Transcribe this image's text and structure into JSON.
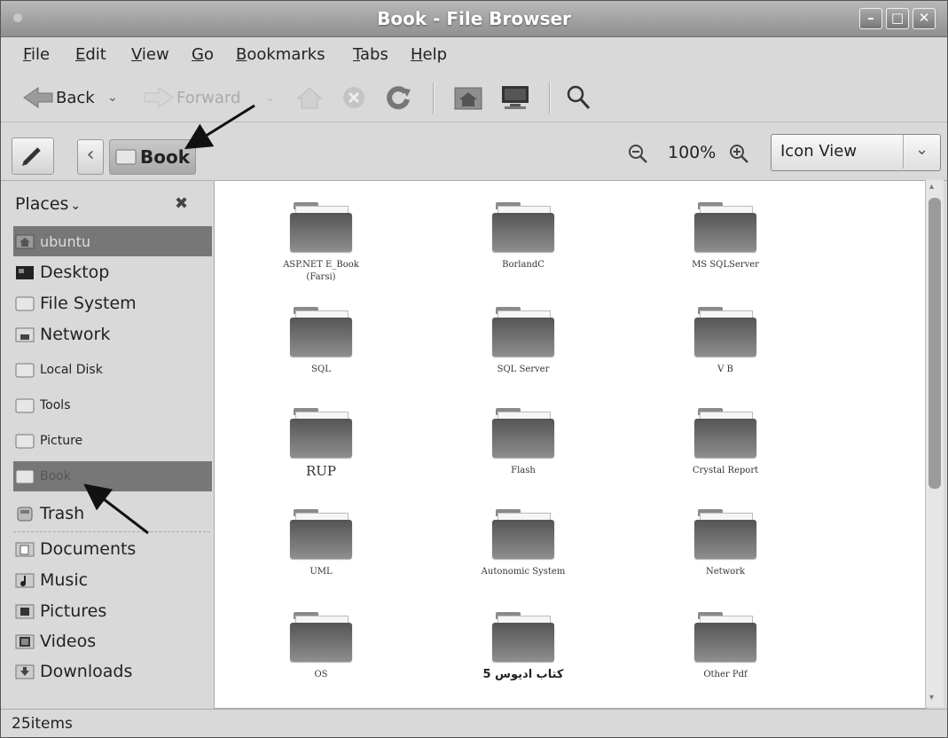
{
  "window": {
    "title": "Book - File Browser",
    "controls": [
      "–",
      "□",
      "✕"
    ]
  },
  "menubar": {
    "items": [
      {
        "pre": "",
        "key": "F",
        "post": "ile"
      },
      {
        "pre": "",
        "key": "E",
        "post": "dit"
      },
      {
        "pre": "",
        "key": "V",
        "post": "iew"
      },
      {
        "pre": "",
        "key": "G",
        "post": "o"
      },
      {
        "pre": "",
        "key": "B",
        "post": "ookmarks"
      },
      {
        "pre": "",
        "key": "T",
        "post": "abs"
      },
      {
        "pre": "",
        "key": "H",
        "post": "elp"
      }
    ]
  },
  "toolbar": {
    "back_label": "Back",
    "forward_label": "Forward",
    "dropdown_glyph": "⌄",
    "back_icon": "back-arrow-icon",
    "forward_icon": "forward-arrow-icon",
    "home_icon": "home-icon",
    "stop_icon": "stop-icon",
    "reload_icon": "reload-icon",
    "computer_home_icon": "home-folder-icon",
    "computer_icon": "computer-icon",
    "search_icon": "search-icon"
  },
  "locationbar": {
    "edit_icon": "pencil-icon",
    "back_glyph": "‹",
    "crumb": "Book",
    "zoom_out_glyph": "🔍",
    "zoom_level": "100%",
    "view_mode": "Icon View",
    "combo_glyph": "⌄"
  },
  "sidebar": {
    "header": "Places",
    "header_glyph": "⌄",
    "close_glyph": "✖",
    "items": [
      {
        "label": "ubuntu",
        "icon": "home-folder-icon"
      },
      {
        "label": "Desktop",
        "icon": "desktop-icon"
      },
      {
        "label": "File System",
        "icon": "drive-icon"
      },
      {
        "label": "Network",
        "icon": "network-icon"
      },
      {
        "label": "Local Disk",
        "icon": "drive-icon"
      },
      {
        "label": "Tools",
        "icon": "drive-icon"
      },
      {
        "label": "Picture",
        "icon": "drive-icon"
      },
      {
        "label": "Book",
        "icon": "drive-icon"
      },
      {
        "label": "Trash",
        "icon": "trash-icon"
      },
      {
        "label": "Documents",
        "icon": "documents-icon"
      },
      {
        "label": "Music",
        "icon": "music-icon"
      },
      {
        "label": "Pictures",
        "icon": "pictures-icon"
      },
      {
        "label": "Videos",
        "icon": "videos-icon"
      },
      {
        "label": "Downloads",
        "icon": "downloads-icon"
      }
    ]
  },
  "content": {
    "folders": [
      {
        "label": "ASP.NET E_Book\n(Farsi)"
      },
      {
        "label": "BorlandC"
      },
      {
        "label": "MS SQLServer"
      },
      {
        "label": "SQL"
      },
      {
        "label": "SQL Server"
      },
      {
        "label": "V B"
      },
      {
        "label": "RUP"
      },
      {
        "label": "Flash"
      },
      {
        "label": "Crystal Report"
      },
      {
        "label": "UML"
      },
      {
        "label": "Autonomic System"
      },
      {
        "label": "Network"
      },
      {
        "label": "OS"
      },
      {
        "label": "کتاب ادیوس 5"
      },
      {
        "label": "Other Pdf"
      }
    ]
  },
  "statusbar": {
    "text": "25items"
  }
}
